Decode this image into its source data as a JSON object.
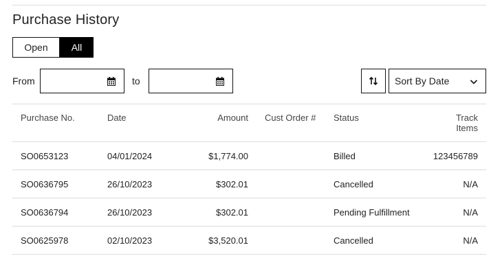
{
  "page": {
    "title": "Purchase History"
  },
  "filter_toggle": {
    "open_label": "Open",
    "all_label": "All",
    "selected": "All"
  },
  "date_filter": {
    "from_label": "From",
    "to_label": "to",
    "from_value": "",
    "to_value": "",
    "icons": {
      "calendar": "calendar-icon"
    }
  },
  "sort": {
    "direction_icon": "sort-direction-icon",
    "selected": "Sort By Date",
    "chevron_icon": "chevron-down-icon"
  },
  "table": {
    "headers": {
      "purchase_no": "Purchase No.",
      "date": "Date",
      "amount": "Amount",
      "cust_order": "Cust Order #",
      "status": "Status",
      "track_line1": "Track",
      "track_line2": "Items"
    },
    "rows": [
      {
        "purchase_no": "SO0653123",
        "date": "04/01/2024",
        "amount": "$1,774.00",
        "cust_order": "",
        "status": "Billed",
        "track": "123456789"
      },
      {
        "purchase_no": "SO0636795",
        "date": "26/10/2023",
        "amount": "$302.01",
        "cust_order": "",
        "status": "Cancelled",
        "track": "N/A"
      },
      {
        "purchase_no": "SO0636794",
        "date": "26/10/2023",
        "amount": "$302.01",
        "cust_order": "",
        "status": "Pending Fulfillment",
        "track": "N/A"
      },
      {
        "purchase_no": "SO0625978",
        "date": "02/10/2023",
        "amount": "$3,520.01",
        "cust_order": "",
        "status": "Cancelled",
        "track": "N/A"
      }
    ]
  }
}
